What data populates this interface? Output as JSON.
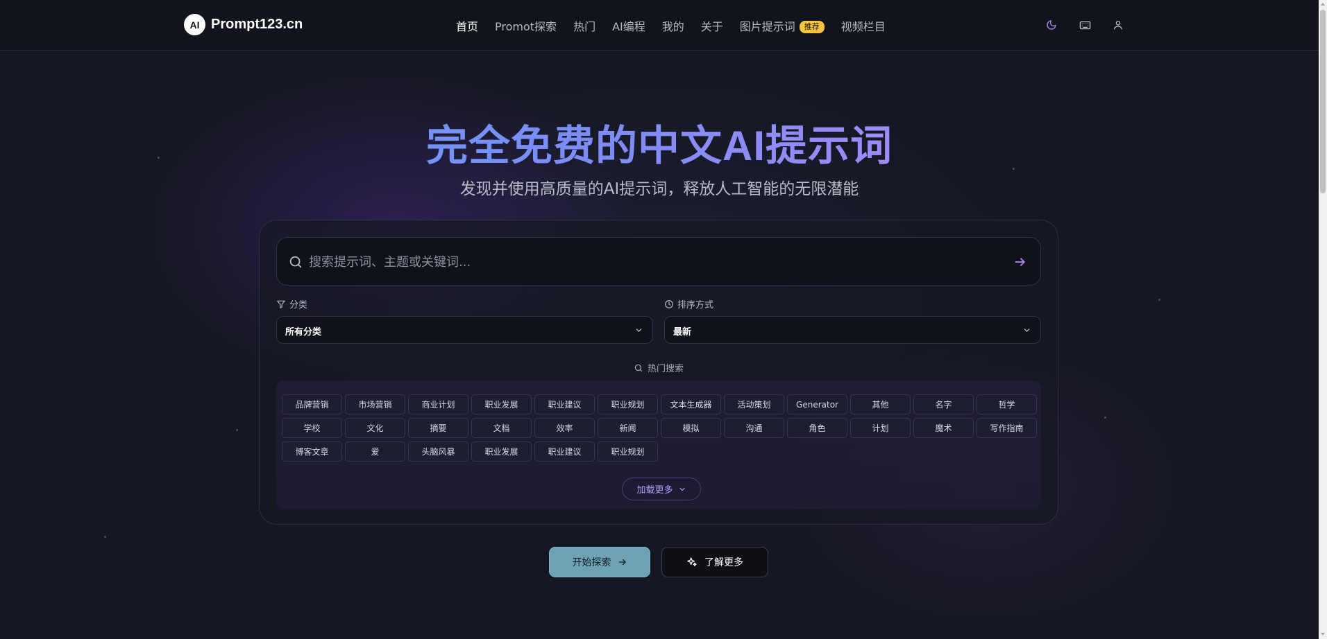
{
  "header": {
    "logo_badge": "AI",
    "logo_text": "Prompt123.cn",
    "nav": [
      {
        "label": "首页"
      },
      {
        "label": "Promot探索"
      },
      {
        "label": "热门"
      },
      {
        "label": "AI编程"
      },
      {
        "label": "我的"
      },
      {
        "label": "关于"
      },
      {
        "label": "图片提示词",
        "badge": "推荐"
      },
      {
        "label": "视频栏目"
      }
    ],
    "icons": [
      "moon-icon",
      "keyboard-icon",
      "user-icon"
    ]
  },
  "hero": {
    "title": "完全免费的中文AI提示词",
    "subtitle": "发现并使用高质量的AI提示词，释放人工智能的无限潜能"
  },
  "search": {
    "placeholder": "搜索提示词、主题或关键词..."
  },
  "filters": {
    "category_label": "分类",
    "category_value": "所有分类",
    "sort_label": "排序方式",
    "sort_value": "最新"
  },
  "hot": {
    "title": "热门搜索",
    "tags": [
      "品牌营销",
      "市场营销",
      "商业计划",
      "职业发展",
      "职业建议",
      "职业规划",
      "文本生成器",
      "活动策划",
      "Generator",
      "其他",
      "名字",
      "哲学",
      "学校",
      "文化",
      "摘要",
      "文档",
      "效率",
      "新闻",
      "模拟",
      "沟通",
      "角色",
      "计划",
      "魔术",
      "写作指南",
      "博客文章",
      "爱",
      "头脑风暴",
      "职业发展",
      "职业建议",
      "职业规划"
    ],
    "load_more": "加载更多"
  },
  "actions": {
    "start": "开始探索",
    "learn_more": "了解更多"
  },
  "colors": {
    "background": "#151722",
    "accent": "#a78bfa",
    "title_gradient_start": "#60a5fa",
    "title_gradient_end": "#c084fc",
    "start_button": "#6ea2b4",
    "badge": "#f5c542"
  }
}
